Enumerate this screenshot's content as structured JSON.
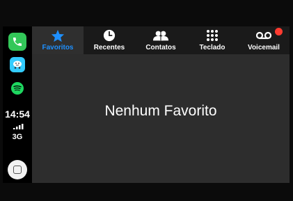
{
  "sidebar": {
    "apps": [
      {
        "name": "phone-app-icon"
      },
      {
        "name": "waze-app-icon"
      },
      {
        "name": "spotify-app-icon"
      }
    ],
    "time": "14:54",
    "network": "3G"
  },
  "tabs": [
    {
      "label": "Favoritos",
      "icon": "star-icon",
      "active": true
    },
    {
      "label": "Recentes",
      "icon": "clock-icon",
      "active": false
    },
    {
      "label": "Contatos",
      "icon": "contacts-icon",
      "active": false
    },
    {
      "label": "Teclado",
      "icon": "keypad-icon",
      "active": false
    },
    {
      "label": "Voicemail",
      "icon": "voicemail-icon",
      "active": false,
      "badge": true
    }
  ],
  "main": {
    "empty_message": "Nenhum Favorito"
  },
  "colors": {
    "accent": "#1e90ff",
    "badge": "#ff3b30",
    "phone": "#33c759",
    "waze": "#33ccff",
    "spotify": "#1ed760"
  }
}
